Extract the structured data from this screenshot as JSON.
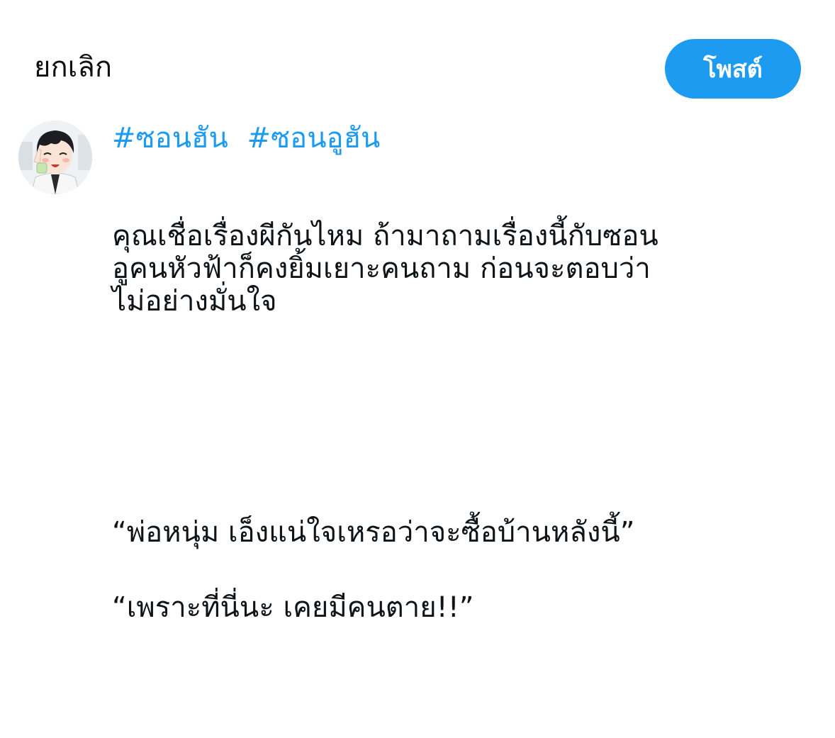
{
  "header": {
    "cancel_label": "ยกเลิก",
    "post_label": "โพสต์"
  },
  "author": {
    "avatar_icon": "anime-boy-avatar-icon"
  },
  "composer": {
    "hashtags": [
      "#ซอนฮัน",
      "#ซอนอูฮัน"
    ],
    "paragraphs": [
      "คุณเชื่อเรื่องผีกันไหม ถ้ามาถามเรื่องนี้กับซอน\nอูคนหัวฟ้าก็คงยิ้มเยาะคนถาม ก่อนจะตอบว่า\nไม่อย่างมั่นใจ",
      "“พ่อหนุ่ม เอ็งแน่ใจเหรอว่าจะซื้อบ้านหลังนี้”",
      "“เพราะที่นี่นะ เคยมีคนตาย!!”"
    ]
  },
  "colors": {
    "accent": "#1d9bf0",
    "text": "#0f1419",
    "background": "#ffffff"
  }
}
